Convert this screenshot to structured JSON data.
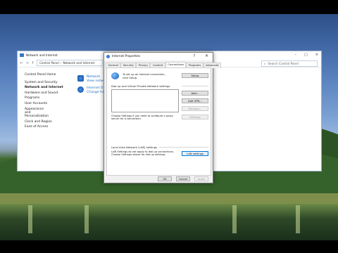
{
  "control_panel": {
    "title": "Network and Internet",
    "address": {
      "parts": [
        "Control Panel",
        "›",
        "Network and Internet"
      ]
    },
    "search_placeholder": "Search Control Panel",
    "sidebar": [
      {
        "label": "Control Panel Home",
        "bold": false
      },
      {
        "label": "System and Security",
        "bold": false
      },
      {
        "label": "Network and Internet",
        "bold": true
      },
      {
        "label": "Hardware and Sound",
        "bold": false
      },
      {
        "label": "Programs",
        "bold": false
      },
      {
        "label": "User Accounts",
        "bold": false
      },
      {
        "label": "Appearance and Personalization",
        "bold": false
      },
      {
        "label": "Clock and Region",
        "bold": false
      },
      {
        "label": "Ease of Access",
        "bold": false
      }
    ],
    "categories": [
      {
        "title": "Network",
        "subtitle": "View netwo"
      },
      {
        "title": "Internet O",
        "subtitle": "Change ho"
      }
    ]
  },
  "dialog": {
    "title": "Internet Properties",
    "help": "?",
    "close": "×",
    "tabs": [
      "General",
      "Security",
      "Privacy",
      "Content",
      "Connections",
      "Programs",
      "Advanced"
    ],
    "active_tab": "Connections",
    "setup_text": "To set up an Internet connection, click Setup.",
    "setup_button": "Setup",
    "vpn_section_label": "Dial-up and Virtual Private Network settings",
    "add_button": "Add...",
    "add_vpn_button": "Add VPN...",
    "remove_button": "Remove...",
    "settings_button": "Settings",
    "proxy_text": "Choose Settings if you need to configure a proxy server for a connection.",
    "lan_section_label": "Local Area Network (LAN) settings",
    "lan_text": "LAN Settings do not apply to dial-up connections. Choose Settings above for dial-up settings.",
    "lan_button": "LAN settings",
    "footer": {
      "ok": "OK",
      "cancel": "Cancel",
      "apply": "Apply"
    }
  }
}
